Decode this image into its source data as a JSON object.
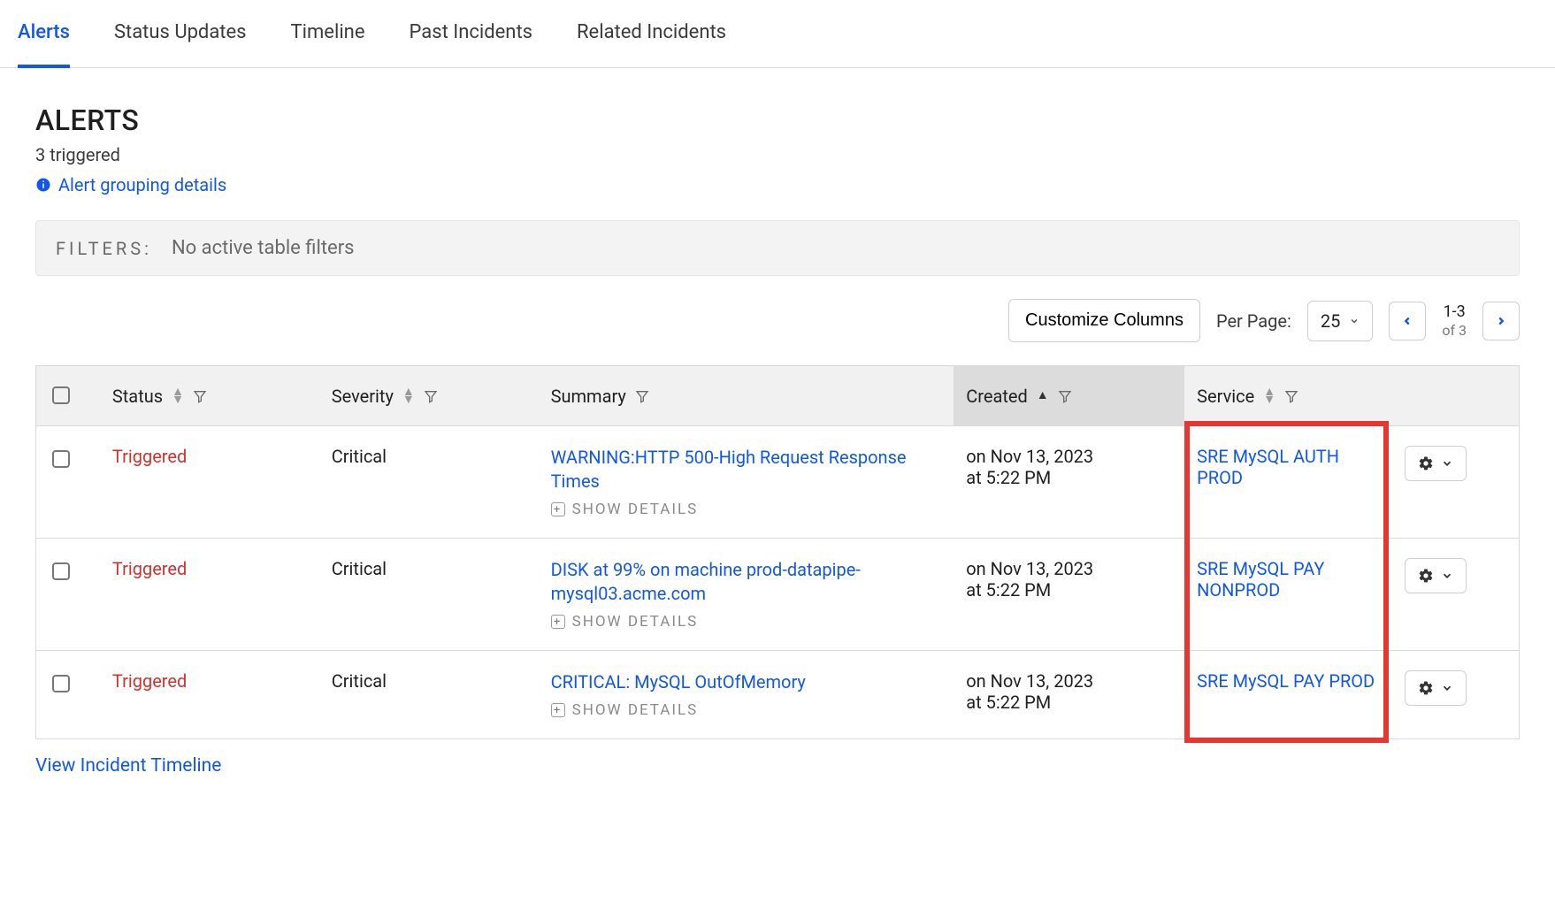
{
  "tabs": [
    {
      "label": "Alerts",
      "active": true
    },
    {
      "label": "Status Updates",
      "active": false
    },
    {
      "label": "Timeline",
      "active": false
    },
    {
      "label": "Past Incidents",
      "active": false
    },
    {
      "label": "Related Incidents",
      "active": false
    }
  ],
  "header": {
    "title": "ALERTS",
    "subtitle": "3 triggered",
    "grouping_link": "Alert grouping details"
  },
  "filters": {
    "label": "FILTERS:",
    "text": "No active table filters"
  },
  "toolbar": {
    "customize_label": "Customize Columns",
    "per_page_label": "Per Page:",
    "per_page_value": "25",
    "pager_range": "1-3",
    "pager_total": "of 3"
  },
  "columns": {
    "status": "Status",
    "severity": "Severity",
    "summary": "Summary",
    "created": "Created",
    "service": "Service"
  },
  "show_details_label": "SHOW DETAILS",
  "rows": [
    {
      "status": "Triggered",
      "severity": "Critical",
      "summary": "WARNING:HTTP 500-High Request Response Times",
      "created_line1": "on Nov 13, 2023",
      "created_line2": "at 5:22 PM",
      "service": "SRE MySQL AUTH PROD"
    },
    {
      "status": "Triggered",
      "severity": "Critical",
      "summary": "DISK at 99% on machine prod-datapipe-mysql03.acme.com",
      "created_line1": "on Nov 13, 2023",
      "created_line2": "at 5:22 PM",
      "service": "SRE MySQL PAY NONPROD"
    },
    {
      "status": "Triggered",
      "severity": "Critical",
      "summary": "CRITICAL: MySQL OutOfMemory",
      "created_line1": "on Nov 13, 2023",
      "created_line2": "at 5:22 PM",
      "service": "SRE MySQL PAY PROD"
    }
  ],
  "footer": {
    "timeline_link": "View Incident Timeline"
  },
  "colors": {
    "blue": "#1157ee",
    "red_status": "#d1332e",
    "highlight": "#e7352f"
  }
}
